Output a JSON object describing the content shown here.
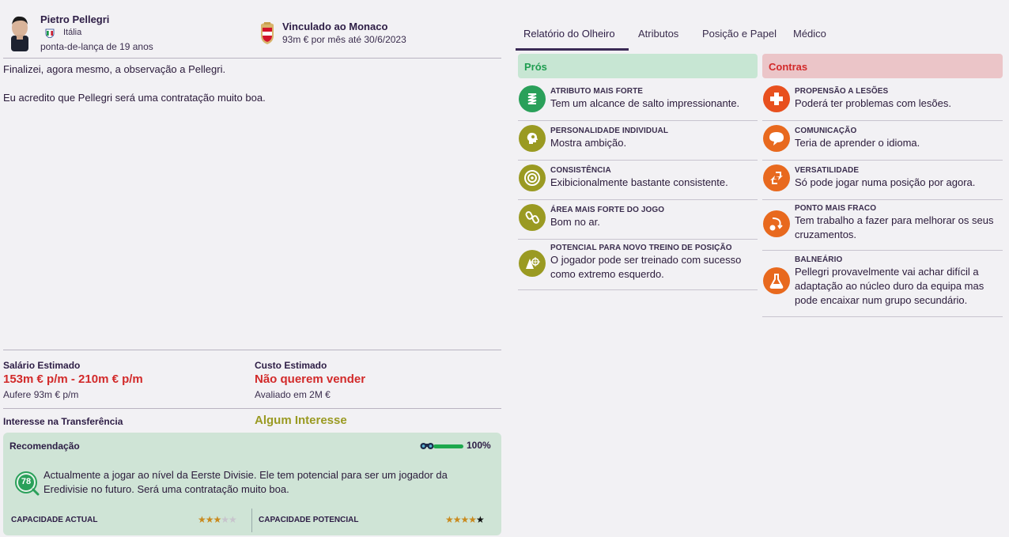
{
  "player": {
    "name": "Pietro Pellegri",
    "nation": "Itália",
    "role": "ponta-de-lança de 19 anos"
  },
  "club": {
    "title": "Vinculado ao Monaco",
    "contract": "93m € por mês até 30/6/2023"
  },
  "report": {
    "line1": "Finalizei, agora mesmo, a observação a Pellegri.",
    "line2": "Eu acredito que Pellegri será uma contratação muito boa."
  },
  "tabs": [
    {
      "label": "Relatório do Olheiro"
    },
    {
      "label": "Atributos"
    },
    {
      "label": "Posição e Papel"
    },
    {
      "label": "Médico"
    }
  ],
  "pros": {
    "title": "Prós",
    "items": [
      {
        "category": "ATRIBUTO MAIS FORTE",
        "text": "Tem um alcance de salto impressionante.",
        "icon": "spring-icon"
      },
      {
        "category": "PERSONALIDADE INDIVIDUAL",
        "text": "Mostra ambição.",
        "icon": "head-icon"
      },
      {
        "category": "CONSISTÊNCIA",
        "text": "Exibicionalmente bastante consistente.",
        "icon": "target-icon"
      },
      {
        "category": "ÁREA MAIS FORTE DO JOGO",
        "text": "Bom no ar.",
        "icon": "chain-icon"
      },
      {
        "category": "POTENCIAL PARA NOVO TREINO DE POSIÇÃO",
        "text": "O jogador pode ser treinado com sucesso como extremo esquerdo.",
        "icon": "cone-icon"
      }
    ]
  },
  "cons": {
    "title": "Contras",
    "items": [
      {
        "category": "PROPENSÃO A LESÕES",
        "text": "Poderá ter problemas com lesões.",
        "icon": "medical-cross-icon"
      },
      {
        "category": "COMUNICAÇÃO",
        "text": "Teria de aprender o idioma.",
        "icon": "speech-bubble-icon"
      },
      {
        "category": "VERSATILIDADE",
        "text": "Só pode jogar numa posição por agora.",
        "icon": "arrows-icon"
      },
      {
        "category": "PONTO MAIS FRACO",
        "text": "Tem trabalho a fazer para melhorar os seus cruzamentos.",
        "icon": "cross-ball-icon"
      },
      {
        "category": "BALNEÁRIO",
        "text": "Pellegri provavelmente vai achar difícil a adaptação ao núcleo duro da equipa mas pode encaixar num grupo secundário.",
        "icon": "flask-icon"
      }
    ]
  },
  "wage": {
    "label": "Salário Estimado",
    "value": "153m € p/m - 210m € p/m",
    "current": "Aufere 93m € p/m"
  },
  "cost": {
    "label": "Custo Estimado",
    "value": "Não querem vender",
    "valuation": "Avaliado em 2M €"
  },
  "interest": {
    "label": "Interesse na Transferência",
    "value": "Algum Interesse"
  },
  "recommendation": {
    "title": "Recomendação",
    "knowledge_pct": "100%",
    "knowledge_fraction": 1.0,
    "badge": "78",
    "text": "Actualmente a jogar ao nível da Eerste Divisie. Ele tem potencial para ser um jogador da Eredivisie no futuro. Será uma contratação muito boa.",
    "current_ability_label": "CAPACIDADE ACTUAL",
    "current_ability_stars": 3,
    "potential_ability_label": "CAPACIDADE POTENCIAL",
    "potential_ability_stars": 4.5
  },
  "colors": {
    "pros_accent": "#1e9d50",
    "cons_accent": "#d22a2a",
    "pros_icon": "#2aa05a",
    "olive_icon": "#9a9a22",
    "cons_icon": "#e8691e"
  }
}
